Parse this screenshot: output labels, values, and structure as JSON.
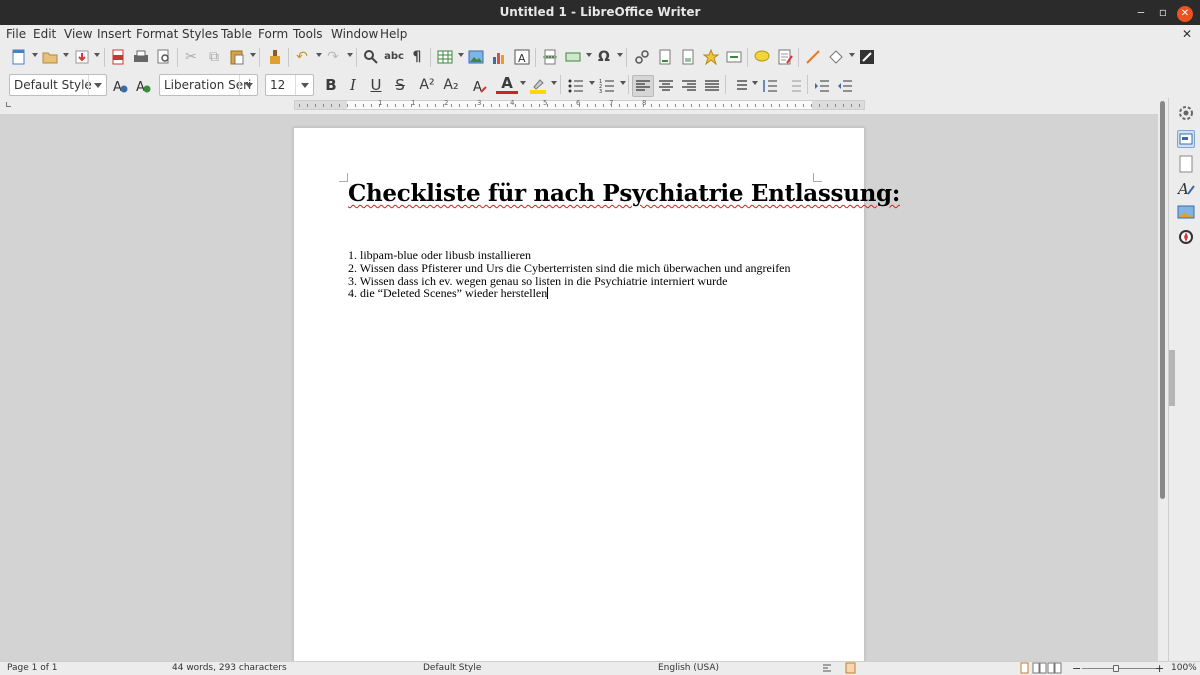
{
  "window": {
    "title": "Untitled 1 - LibreOffice Writer",
    "minimize": "‒",
    "maximize": "▫",
    "close": "✕"
  },
  "menu": [
    "File",
    "Edit",
    "View",
    "Insert",
    "Format",
    "Styles",
    "Table",
    "Form",
    "Tools",
    "Window",
    "Help"
  ],
  "menu_close": "✕",
  "formatting": {
    "paragraph_style": "Default Style",
    "font_name": "Liberation Seri",
    "font_size": "12",
    "bold": "B",
    "italic": "I",
    "underline": "U",
    "strikethrough": "S",
    "superscript": "A²",
    "subscript": "A₂",
    "font_color": "A",
    "highlight_color": "#ffd700",
    "font_color_value": "#d42020"
  },
  "ruler": {
    "numbers": [
      "1",
      "1",
      "2",
      "3",
      "4",
      "5",
      "6",
      "7",
      "8",
      "9",
      "10",
      "11",
      "12",
      "13",
      "14",
      "15",
      "16",
      "17",
      "18"
    ]
  },
  "document": {
    "title": "Checkliste für nach Psychiatrie Entlassung:",
    "list_items": [
      "1. libpam-blue oder libusb installieren",
      "2. Wissen dass Pfisterer und Urs die Cyberterristen sind die mich überwachen und angreifen",
      "3. Wissen dass ich ev. wegen genau so listen in die Psychiatrie interniert wurde",
      "4. die “Deleted Scenes” wieder herstellen"
    ]
  },
  "status": {
    "page": "Page 1 of 1",
    "words": "44 words, 293 characters",
    "style": "Default Style",
    "language": "English (USA)",
    "zoom": "100%",
    "zoom_minus": "−",
    "zoom_plus": "+"
  },
  "colors": {
    "titlebar": "#2b2b2b",
    "close_button": "#e95420",
    "toolbar_bg": "#ececec",
    "spellcheck_underline": "#d42020"
  }
}
